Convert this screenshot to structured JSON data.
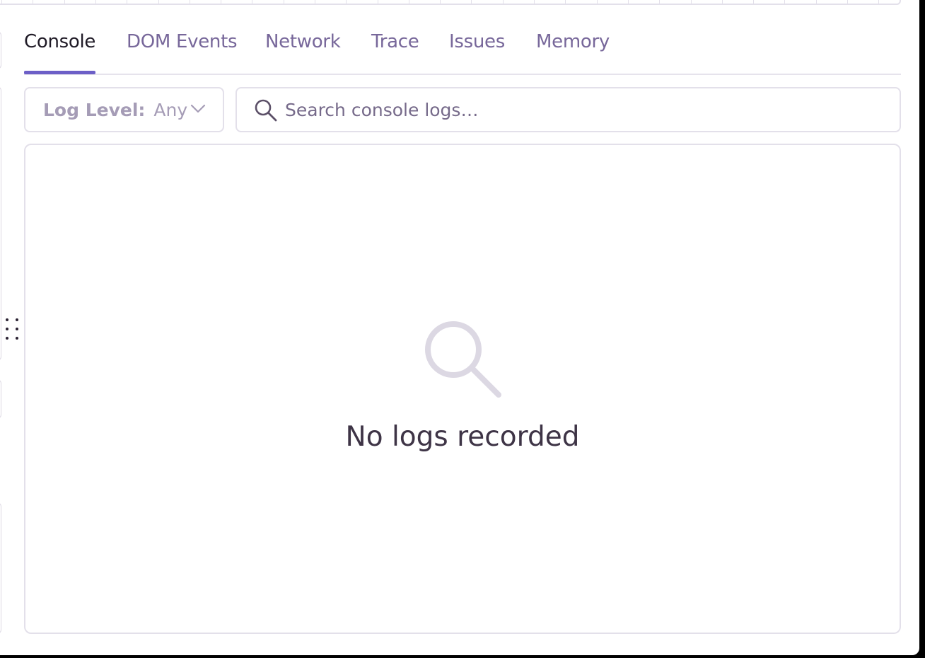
{
  "tabs": [
    {
      "label": "Console",
      "active": true
    },
    {
      "label": "DOM Events",
      "active": false
    },
    {
      "label": "Network",
      "active": false
    },
    {
      "label": "Trace",
      "active": false
    },
    {
      "label": "Issues",
      "active": false
    },
    {
      "label": "Memory",
      "active": false
    }
  ],
  "filters": {
    "log_level_label": "Log Level:",
    "log_level_value": "Any",
    "search_placeholder": "Search console logs…"
  },
  "empty_state": {
    "message": "No logs recorded",
    "icon": "search-icon"
  },
  "colors": {
    "accent": "#6c5fc7",
    "tab_inactive": "#77679a",
    "tab_active": "#1f1a26",
    "border": "#e3e0ea",
    "empty_icon": "#dcd8e3"
  }
}
